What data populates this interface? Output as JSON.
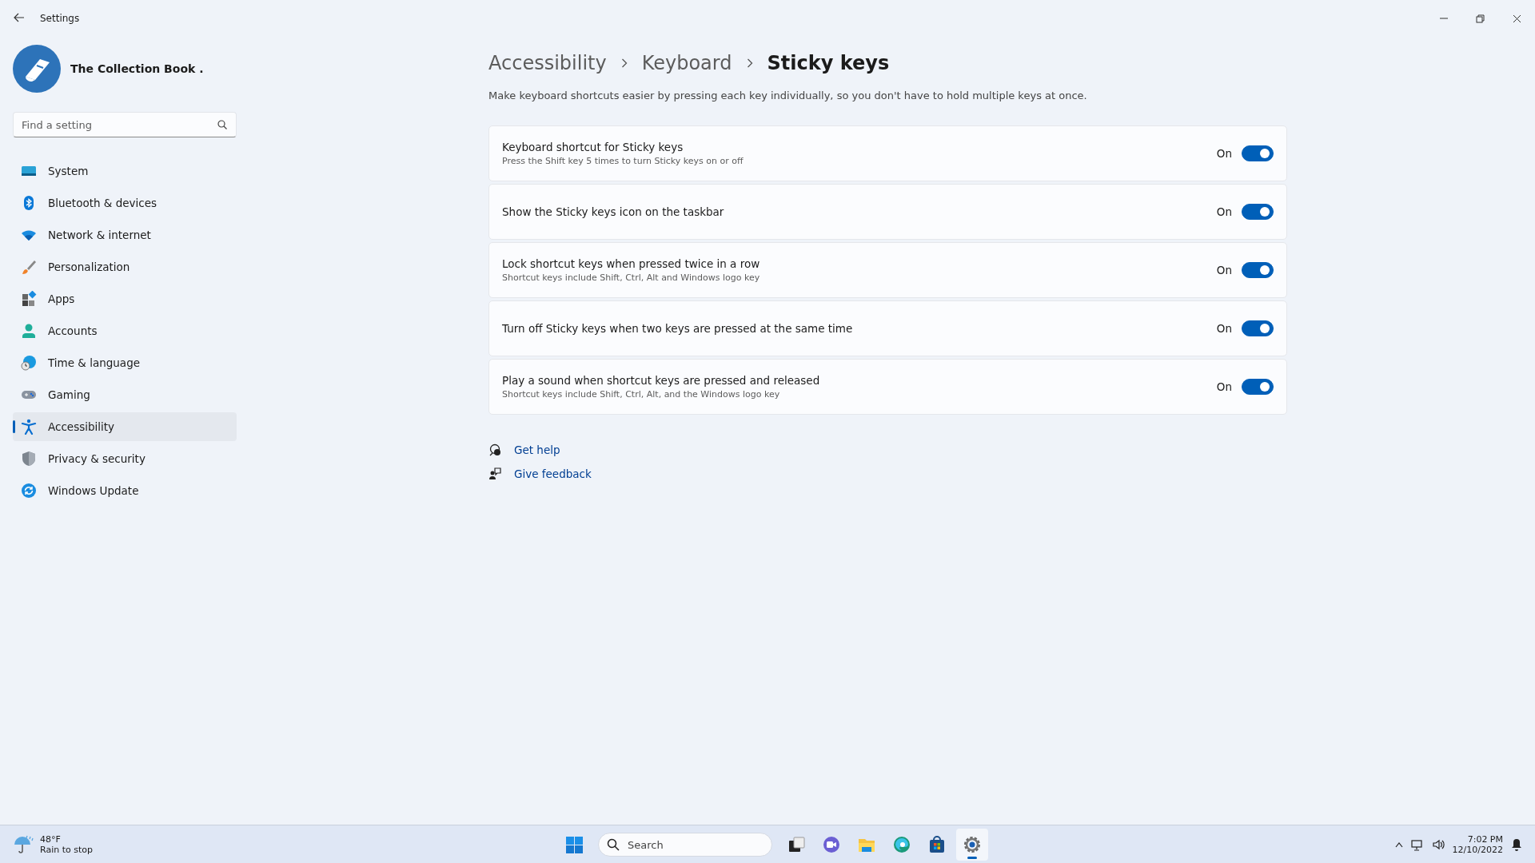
{
  "window": {
    "title": "Settings"
  },
  "profile": {
    "name": "The Collection Book ."
  },
  "search": {
    "placeholder": "Find a setting"
  },
  "nav": [
    {
      "label": "System",
      "kind": "system",
      "selected": false
    },
    {
      "label": "Bluetooth & devices",
      "kind": "bluetooth",
      "selected": false
    },
    {
      "label": "Network & internet",
      "kind": "wifi",
      "selected": false
    },
    {
      "label": "Personalization",
      "kind": "brush",
      "selected": false
    },
    {
      "label": "Apps",
      "kind": "apps",
      "selected": false
    },
    {
      "label": "Accounts",
      "kind": "person",
      "selected": false
    },
    {
      "label": "Time & language",
      "kind": "globe",
      "selected": false
    },
    {
      "label": "Gaming",
      "kind": "gamepad",
      "selected": false
    },
    {
      "label": "Accessibility",
      "kind": "accessibility",
      "selected": true
    },
    {
      "label": "Privacy & security",
      "kind": "shield",
      "selected": false
    },
    {
      "label": "Windows Update",
      "kind": "update",
      "selected": false
    }
  ],
  "breadcrumb": [
    "Accessibility",
    "Keyboard",
    "Sticky keys"
  ],
  "description": "Make keyboard shortcuts easier by pressing each key individually, so you don't have to hold multiple keys at once.",
  "settings": [
    {
      "title": "Keyboard shortcut for Sticky keys",
      "subtitle": "Press the Shift key 5 times to turn Sticky keys on or off",
      "state_label": "On",
      "on": true
    },
    {
      "title": "Show the Sticky keys icon on the taskbar",
      "state_label": "On",
      "on": true
    },
    {
      "title": "Lock shortcut keys when pressed twice in a row",
      "subtitle": "Shortcut keys include Shift, Ctrl, Alt and Windows logo key",
      "state_label": "On",
      "on": true
    },
    {
      "title": "Turn off Sticky keys when two keys are pressed at the same time",
      "state_label": "On",
      "on": true
    },
    {
      "title": "Play a sound when shortcut keys are pressed and released",
      "subtitle": "Shortcut keys include Shift, Ctrl, Alt, and the Windows logo key",
      "state_label": "On",
      "on": true
    }
  ],
  "links": [
    {
      "label": "Get help",
      "kind": "help"
    },
    {
      "label": "Give feedback",
      "kind": "feedback"
    }
  ],
  "taskbar": {
    "weather": {
      "temperature": "48°F",
      "condition": "Rain to stop"
    },
    "search": {
      "placeholder": "Search"
    },
    "apps": [
      {
        "kind": "start",
        "selected": false
      },
      {
        "kind": "taskview",
        "selected": false
      },
      {
        "kind": "chat",
        "selected": false
      },
      {
        "kind": "files",
        "selected": false
      },
      {
        "kind": "browser",
        "selected": false
      },
      {
        "kind": "store",
        "selected": false
      },
      {
        "kind": "settings",
        "selected": true
      }
    ],
    "time": "7:02 PM",
    "date": "12/10/2022"
  }
}
